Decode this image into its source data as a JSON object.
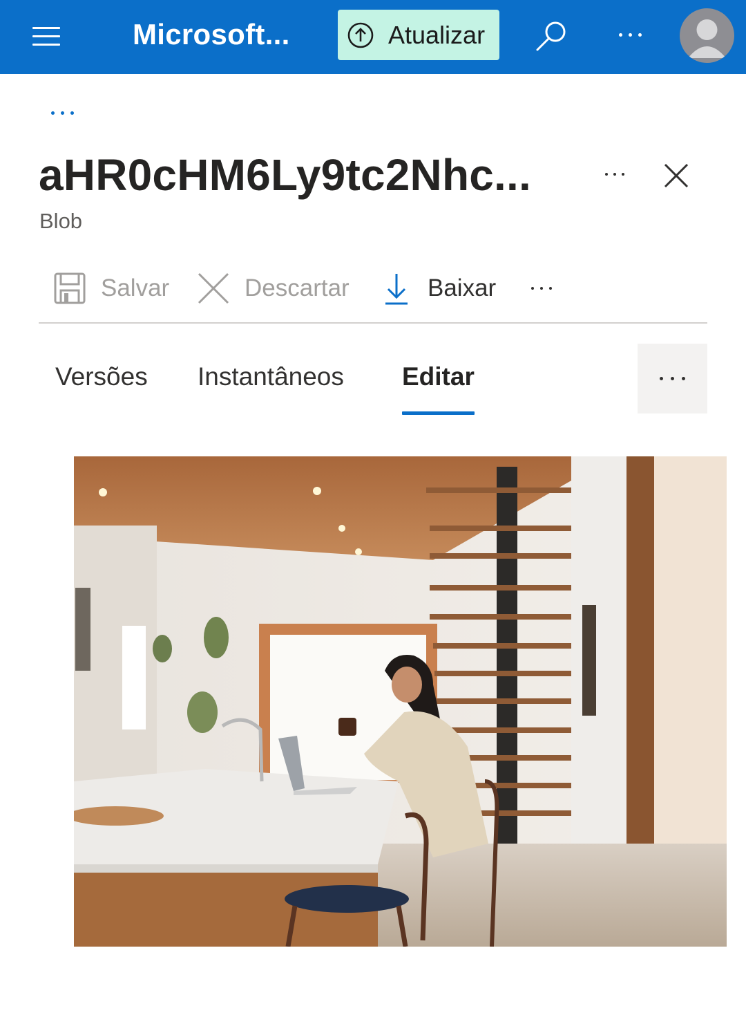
{
  "header": {
    "menu_icon": "hamburger-menu-icon",
    "app_title": "Microsoft...",
    "update_button": {
      "label": "Atualizar",
      "icon": "arrow-up-circle-icon"
    },
    "search_icon": "search-icon",
    "more_icon": "more-horizontal-icon",
    "avatar_icon": "user-avatar-icon",
    "colors": {
      "bar": "#0B6FC9",
      "update_bg": "#C4F3E4"
    }
  },
  "breadcrumb": {
    "more_icon": "more-horizontal-icon"
  },
  "blob": {
    "name": "aHR0cHM6Ly9tc2Nhc...",
    "type": "Blob"
  },
  "commands": {
    "save": {
      "label": "Salvar",
      "icon": "save-icon",
      "enabled": false
    },
    "discard": {
      "label": "Descartar",
      "icon": "close-icon",
      "enabled": false
    },
    "download": {
      "label": "Baixar",
      "icon": "download-icon",
      "enabled": true
    },
    "more_icon": "more-horizontal-icon"
  },
  "tabs": [
    {
      "label": "Versões",
      "active": false
    },
    {
      "label": "Instantâneos",
      "active": false
    },
    {
      "label": "Editar",
      "active": true
    }
  ],
  "tabs_more_icon": "more-horizontal-icon",
  "preview": {
    "description_icon": "image-preview",
    "accent": "#0B6FC9"
  }
}
